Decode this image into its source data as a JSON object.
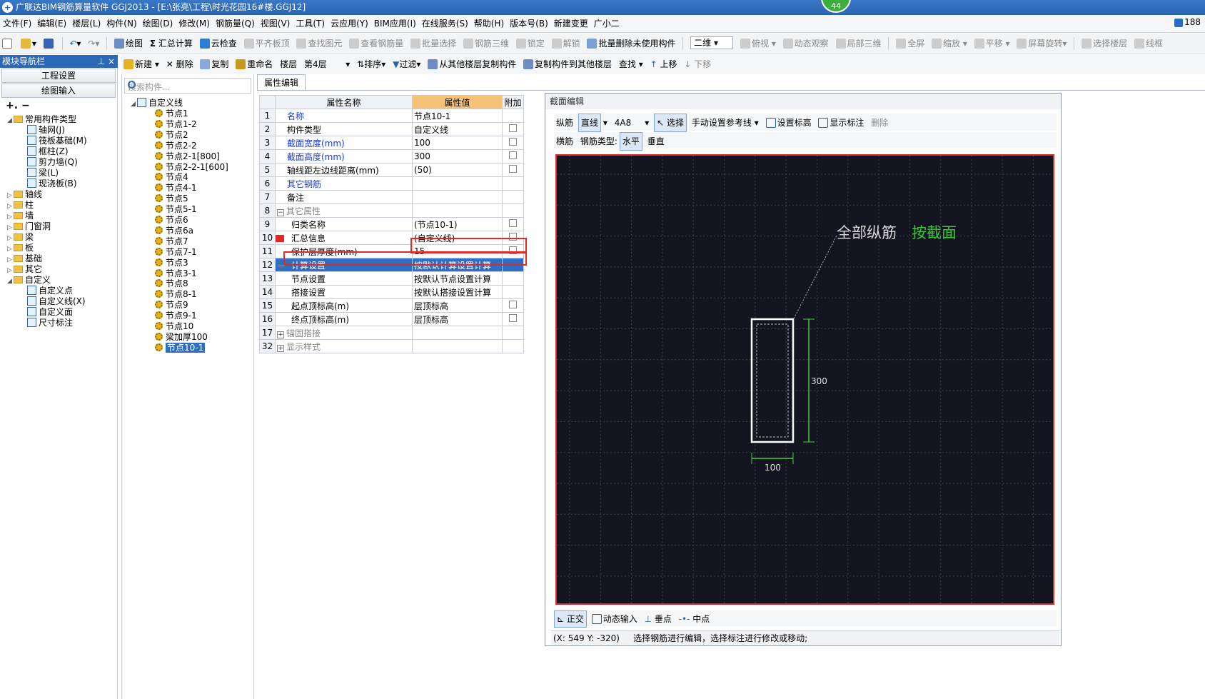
{
  "window": {
    "title": "广联达BIM钢筋算量软件 GGJ2013 - [E:\\张亮\\工程\\时光花园16#楼.GGJ12]",
    "badge": "44",
    "user_num": "188"
  },
  "menu": [
    "文件(F)",
    "编辑(E)",
    "楼层(L)",
    "构件(N)",
    "绘图(D)",
    "修改(M)",
    "钢筋量(Q)",
    "视图(V)",
    "工具(T)",
    "云应用(Y)",
    "BIM应用(I)",
    "在线服务(S)",
    "帮助(H)",
    "版本号(B)",
    "新建变更",
    "广小二"
  ],
  "toolbar1": {
    "draw": "绘图",
    "sum": "汇总计算",
    "cloud_check": "云检查",
    "flat_slab": "平齐板顶",
    "find_elem": "查找图元",
    "view_rebar": "查看钢筋量",
    "batch_select": "批量选择",
    "rebar_3d": "钢筋三维",
    "lock": "锁定",
    "unlock": "解锁",
    "batch_delete": "批量删除未使用构件",
    "view_mode": "二维",
    "top_view": "俯视",
    "dynamic": "动态观察",
    "local_3d": "局部三维",
    "fullscreen": "全屏",
    "zoom": "缩放",
    "pan": "平移",
    "rotate": "屏幕旋转",
    "select_floor": "选择楼层",
    "wireframe": "线框"
  },
  "toolbar2": {
    "new": "新建",
    "delete": "删除",
    "copy": "复制",
    "rename": "重命名",
    "floor_label": "楼层",
    "floor_value": "第4层",
    "sort": "排序",
    "filter": "过滤",
    "copy_from": "从其他楼层复制构件",
    "copy_to": "复制构件到其他楼层",
    "find": "查找",
    "up": "上移",
    "down": "下移"
  },
  "nav": {
    "title": "模块导航栏",
    "btn_project": "工程设置",
    "btn_draw": "绘图输入",
    "tree": [
      {
        "label": "常用构件类型",
        "level": 0,
        "type": "folder",
        "open": true
      },
      {
        "label": "轴网(J)",
        "level": 1,
        "type": "item"
      },
      {
        "label": "筏板基础(M)",
        "level": 1,
        "type": "item"
      },
      {
        "label": "框柱(Z)",
        "level": 1,
        "type": "item"
      },
      {
        "label": "剪力墙(Q)",
        "level": 1,
        "type": "item"
      },
      {
        "label": "梁(L)",
        "level": 1,
        "type": "item"
      },
      {
        "label": "现浇板(B)",
        "level": 1,
        "type": "item"
      },
      {
        "label": "轴线",
        "level": 0,
        "type": "folder"
      },
      {
        "label": "柱",
        "level": 0,
        "type": "folder"
      },
      {
        "label": "墙",
        "level": 0,
        "type": "folder"
      },
      {
        "label": "门窗洞",
        "level": 0,
        "type": "folder"
      },
      {
        "label": "梁",
        "level": 0,
        "type": "folder"
      },
      {
        "label": "板",
        "level": 0,
        "type": "folder"
      },
      {
        "label": "基础",
        "level": 0,
        "type": "folder"
      },
      {
        "label": "其它",
        "level": 0,
        "type": "folder"
      },
      {
        "label": "自定义",
        "level": 0,
        "type": "folder",
        "open": true
      },
      {
        "label": "自定义点",
        "level": 1,
        "type": "item"
      },
      {
        "label": "自定义线(X)",
        "level": 1,
        "type": "item"
      },
      {
        "label": "自定义面",
        "level": 1,
        "type": "item"
      },
      {
        "label": "尺寸标注",
        "level": 1,
        "type": "item"
      }
    ]
  },
  "components": {
    "search_placeholder": "搜索构件...",
    "root": "自定义线",
    "items": [
      "节点1",
      "节点1-2",
      "节点2",
      "节点2-2",
      "节点2-1[800]",
      "节点2-2-1[600]",
      "节点4",
      "节点4-1",
      "节点5",
      "节点5-1",
      "节点6",
      "节点6a",
      "节点7",
      "节点7-1",
      "节点3",
      "节点3-1",
      "节点8",
      "节点8-1",
      "节点9",
      "节点9-1",
      "节点10",
      "梁加厚100",
      "节点10-1"
    ],
    "selected": "节点10-1"
  },
  "props": {
    "tab": "属性编辑",
    "headers": [
      "属性名称",
      "属性值",
      "附加"
    ],
    "rows": [
      {
        "no": "1",
        "name": "名称",
        "value": "节点10-1",
        "blue": true,
        "cb": false
      },
      {
        "no": "2",
        "name": "构件类型",
        "value": "自定义线",
        "cb": true
      },
      {
        "no": "3",
        "name": "截面宽度(mm)",
        "value": "100",
        "blue": true,
        "cb": true
      },
      {
        "no": "4",
        "name": "截面高度(mm)",
        "value": "300",
        "blue": true,
        "cb": true
      },
      {
        "no": "5",
        "name": "轴线距左边线距离(mm)",
        "value": "(50)",
        "cb": true
      },
      {
        "no": "6",
        "name": "其它钢筋",
        "value": "",
        "blue": true,
        "cb": false
      },
      {
        "no": "7",
        "name": "备注",
        "value": "",
        "cb": false
      },
      {
        "no": "8",
        "name": "其它属性",
        "value": "",
        "grey": true,
        "group": true,
        "cb": false
      },
      {
        "no": "9",
        "name": "归类名称",
        "value": "(节点10-1)",
        "indent": true,
        "cb": true
      },
      {
        "no": "10",
        "name": "汇总信息",
        "value": "(自定义线)",
        "indent": true,
        "cb": true
      },
      {
        "no": "11",
        "name": "保护层厚度(mm)",
        "value": "15",
        "indent": true,
        "cb": true
      },
      {
        "no": "12",
        "name": "计算设置",
        "value": "按默认计算设置计算",
        "indent": true,
        "sel": true,
        "cb": false
      },
      {
        "no": "13",
        "name": "节点设置",
        "value": "按默认节点设置计算",
        "indent": true,
        "cb": false
      },
      {
        "no": "14",
        "name": "搭接设置",
        "value": "按默认搭接设置计算",
        "indent": true,
        "cb": false
      },
      {
        "no": "15",
        "name": "起点顶标高(m)",
        "value": "层顶标高",
        "indent": true,
        "cb": true
      },
      {
        "no": "16",
        "name": "终点顶标高(m)",
        "value": "层顶标高",
        "indent": true,
        "cb": true
      },
      {
        "no": "17",
        "name": "锚固搭接",
        "value": "",
        "grey": true,
        "group": true,
        "plus": true,
        "cb": false
      },
      {
        "no": "32",
        "name": "显示样式",
        "value": "",
        "grey": true,
        "group": true,
        "plus": true,
        "cb": false
      }
    ]
  },
  "dialog": {
    "title": "截面编辑",
    "t1": {
      "long": "纵筋",
      "line": "直线",
      "spec": "4A8",
      "select": "选择",
      "ref_line": "手动设置参考线",
      "set_elev": "设置标高",
      "show_dim": "显示标注",
      "delete": "删除"
    },
    "t2": {
      "stirrup": "横筋",
      "rebar_type": "钢筋类型:",
      "horizontal": "水平",
      "vertical": "垂直"
    },
    "canvas": {
      "label_white": "全部纵筋",
      "label_green": "按截面",
      "dim_h": "300",
      "dim_w": "100",
      "rect": {
        "width_mm": 100,
        "height_mm": 300
      }
    },
    "status": {
      "ortho": "正交",
      "dyn_input": "动态输入",
      "perp": "垂点",
      "mid": "中点"
    },
    "coord": "(X: 549 Y: -320)",
    "hint": "选择钢筋进行编辑，选择标注进行修改或移动;"
  },
  "colors": {
    "canvas_bg": "#141420",
    "highlight": "#e02a2a",
    "green_text": "#2ecc2e",
    "dim_green": "#3ecf3e",
    "select": "#2e6fc4",
    "header_orange": "#f6c277"
  }
}
